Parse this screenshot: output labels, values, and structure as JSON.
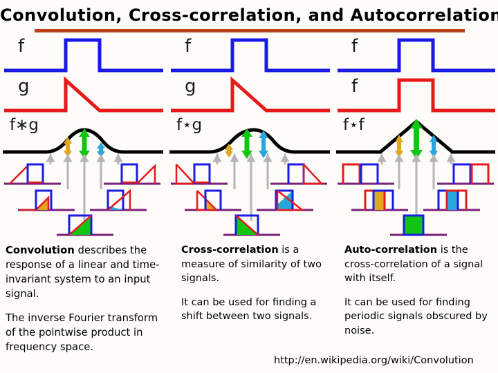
{
  "title": "Convolution, Cross-correlation, and Autocorrelation",
  "accent_rule_color": "#b8431a",
  "palette": {
    "f_color": "#1a1ae6",
    "g_color": "#e61a1a",
    "result_color": "#000000",
    "axis_color": "#7a1f7a",
    "arrow_left": "#e0a81e",
    "arrow_center": "#13c413",
    "arrow_right": "#2aa6de",
    "guide_color": "#b0b0b0",
    "fill_orange": "#e0a81e",
    "fill_green": "#13c413",
    "fill_blue": "#2aa6de",
    "background": "#fdfcf8"
  },
  "columns": [
    {
      "id": "convolution",
      "waves": [
        {
          "label": "f",
          "shape": "rect",
          "color": "#1a1ae6"
        },
        {
          "label": "g",
          "shape": "sawtooth-decay",
          "color": "#e61a1a"
        },
        {
          "label": "f∗g",
          "shape": "smooth-bump",
          "color": "#000000"
        }
      ],
      "arrows": [
        {
          "name": "arrow-orange",
          "color": "#e0a81e"
        },
        {
          "name": "arrow-green",
          "color": "#13c413"
        },
        {
          "name": "arrow-blue",
          "color": "#2aa6de"
        }
      ],
      "overlap_panels": [
        {
          "position": "far-left",
          "fill": "none"
        },
        {
          "position": "left",
          "fill": "#e0a81e"
        },
        {
          "position": "center",
          "fill": "#13c413"
        },
        {
          "position": "right",
          "fill": "#2aa6de"
        },
        {
          "position": "far-right",
          "fill": "none"
        }
      ]
    },
    {
      "id": "cross-correlation",
      "waves": [
        {
          "label": "f",
          "shape": "rect",
          "color": "#1a1ae6"
        },
        {
          "label": "g",
          "shape": "sawtooth-decay",
          "color": "#e61a1a"
        },
        {
          "label": "f⋆g",
          "shape": "smooth-bump",
          "color": "#000000"
        }
      ],
      "arrows": [
        {
          "name": "arrow-orange",
          "color": "#e0a81e"
        },
        {
          "name": "arrow-green",
          "color": "#13c413"
        },
        {
          "name": "arrow-blue",
          "color": "#2aa6de"
        }
      ],
      "overlap_panels": [
        {
          "position": "far-left",
          "fill": "none"
        },
        {
          "position": "left",
          "fill": "#e0a81e"
        },
        {
          "position": "center",
          "fill": "#13c413"
        },
        {
          "position": "right",
          "fill": "#2aa6de"
        },
        {
          "position": "far-right",
          "fill": "none"
        }
      ]
    },
    {
      "id": "autocorrelation",
      "waves": [
        {
          "label": "f",
          "shape": "rect",
          "color": "#1a1ae6"
        },
        {
          "label": "f",
          "shape": "rect",
          "color": "#e61a1a"
        },
        {
          "label": "f⋆f",
          "shape": "triangle",
          "color": "#000000"
        }
      ],
      "arrows": [
        {
          "name": "arrow-orange",
          "color": "#e0a81e"
        },
        {
          "name": "arrow-green",
          "color": "#13c413"
        },
        {
          "name": "arrow-blue",
          "color": "#2aa6de"
        }
      ],
      "overlap_panels": [
        {
          "position": "far-left",
          "fill": "none"
        },
        {
          "position": "left",
          "fill": "#e0a81e"
        },
        {
          "position": "center",
          "fill": "#13c413"
        },
        {
          "position": "right",
          "fill": "#2aa6de"
        },
        {
          "position": "far-right",
          "fill": "none"
        }
      ]
    }
  ],
  "text": {
    "convolution": {
      "p1_lead": "Convolution",
      "p1_rest": " describes the response of a linear and time-invariant system to an input signal.",
      "p2": "The inverse Fourier transform of the pointwise product in frequency space."
    },
    "cross_correlation": {
      "p1_lead": "Cross-correlation",
      "p1_rest": " is a measure of similarity of two signals.",
      "p2": "It can be used for finding a shift between two signals."
    },
    "autocorrelation": {
      "p1_lead": "Auto-correlation",
      "p1_rest": " is the cross-correlation of a signal with itself.",
      "p2": "It can be used for finding periodic signals obscured by noise."
    }
  },
  "source_url": "http://en.wikipedia.org/wiki/Convolution"
}
